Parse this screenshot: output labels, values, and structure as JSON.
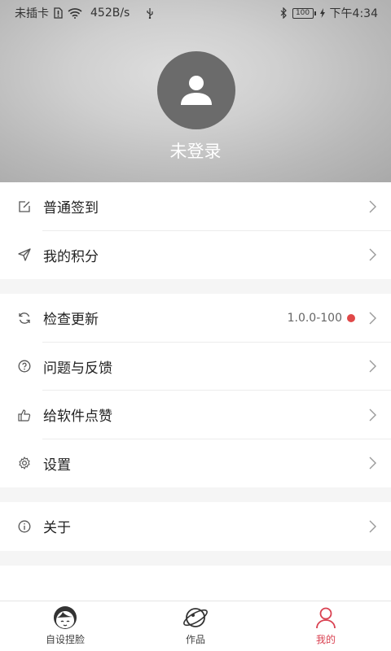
{
  "statusbar": {
    "carrier": "未插卡",
    "speed": "452B/s",
    "battery": "100",
    "time": "下午4:34"
  },
  "profile": {
    "status": "未登录"
  },
  "groups": [
    [
      {
        "label": "普通签到",
        "icon": "edit-icon"
      },
      {
        "label": "我的积分",
        "icon": "send-icon"
      }
    ],
    [
      {
        "label": "检查更新",
        "icon": "refresh-icon",
        "value": "1.0.0-100"
      },
      {
        "label": "问题与反馈",
        "icon": "question-icon"
      },
      {
        "label": "给软件点赞",
        "icon": "thumbs-up-icon"
      },
      {
        "label": "设置",
        "icon": "gear-icon"
      }
    ],
    [
      {
        "label": "关于",
        "icon": "info-icon"
      }
    ]
  ],
  "nav": [
    {
      "label": "自设捏脸",
      "icon": "face-avatar-icon",
      "active": false
    },
    {
      "label": "作品",
      "icon": "planet-icon",
      "active": false
    },
    {
      "label": "我的",
      "icon": "person-icon",
      "active": true
    }
  ],
  "colors": {
    "accent": "#d94050",
    "badge": "#e04848"
  }
}
